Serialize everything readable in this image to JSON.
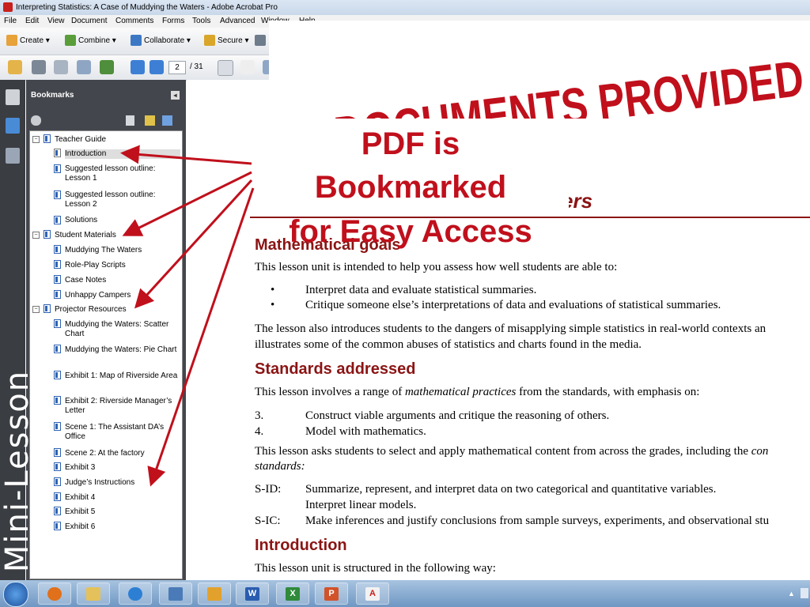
{
  "window": {
    "title": "Interpreting Statistics: A Case of Muddying the Waters - Adobe Acrobat Pro"
  },
  "menu": [
    "File",
    "Edit",
    "View",
    "Document",
    "Comments",
    "Forms",
    "Tools",
    "Advanced",
    "Window",
    "Help"
  ],
  "toolbar1": {
    "create": "Create ▾",
    "combine": "Combine ▾",
    "collaborate": "Collaborate ▾",
    "secure": "Secure ▾"
  },
  "toolbar2": {
    "page_current": "2",
    "page_total": "/ 31"
  },
  "bookmarks": {
    "title": "Bookmarks",
    "groups": [
      {
        "label": "Teacher Guide",
        "items": [
          "Introduction",
          "Suggested lesson outline: Lesson 1",
          "Suggested lesson outline: Lesson 2",
          "Solutions"
        ]
      },
      {
        "label": "Student Materials",
        "items": [
          "Muddying The Waters",
          "Role-Play Scripts",
          "Case Notes",
          "Unhappy Campers"
        ]
      },
      {
        "label": "Projector Resources",
        "items": [
          "Muddying the Waters: Scatter Chart",
          "Muddying the Waters: Pie Chart",
          "Exhibit 1: Map of Riverside Area",
          "Exhibit 2: Riverside Manager’s Letter",
          "Scene 1: The Assistant DA’s Office",
          "Scene 2: At the factory",
          "Exhibit 3",
          "Judge’s Instructions",
          "Exhibit 4",
          "Exhibit 5",
          "Exhibit 6"
        ]
      }
    ]
  },
  "document": {
    "title_fragment": "ers",
    "goals_heading": "Mathematical goals",
    "goals_intro": "This lesson unit is intended to help you assess how well students are able to:",
    "goals_bullets": [
      "Interpret data and evaluate statistical summaries.",
      "Critique someone else’s interpretations of data and evaluations of statistical summaries."
    ],
    "goals_para_1": "The lesson also introduces students to the dangers of misapplying simple statistics in real-world contexts an",
    "goals_para_2": "illustrates some of the common abuses of statistics and charts found in the media.",
    "standards_heading": "Standards addressed",
    "standards_intro_before": "This lesson involves a range of ",
    "standards_intro_em": "mathematical practices",
    "standards_intro_after": " from the standards, with emphasis on:",
    "practices": [
      {
        "num": "3.",
        "text": "Construct viable arguments and critique the reasoning of others."
      },
      {
        "num": "4.",
        "text": "Model with mathematics."
      }
    ],
    "content_para_before": "This lesson asks students to select and apply mathematical content from across the grades, including the ",
    "content_para_em": "con",
    "content_para_line2": "standards:",
    "content_standards": [
      {
        "code": "S-ID:",
        "text": "Summarize, represent, and interpret data on two categorical and quantitative variables."
      },
      {
        "code": "",
        "text": "Interpret linear models."
      },
      {
        "code": "S-IC:",
        "text": "Make inferences and justify conclusions from sample surveys, experiments, and observational stu"
      }
    ],
    "intro_heading": "Introduction",
    "intro_text": "This lesson unit is structured in the following way:"
  },
  "overlays": {
    "banner": "AL DOCUMENTS PROVIDED",
    "callout": [
      "PDF is",
      "Bookmarked",
      "for Easy Access"
    ],
    "side_label": "Mini-Lesson"
  },
  "colors": {
    "accent_red": "#c0101c",
    "doc_red": "#8b1414"
  },
  "taskbar": {
    "apps": [
      "windows-start",
      "media-player",
      "file-explorer",
      "internet-explorer",
      "remote-desktop",
      "outlook",
      "word",
      "excel",
      "powerpoint",
      "acrobat"
    ]
  }
}
